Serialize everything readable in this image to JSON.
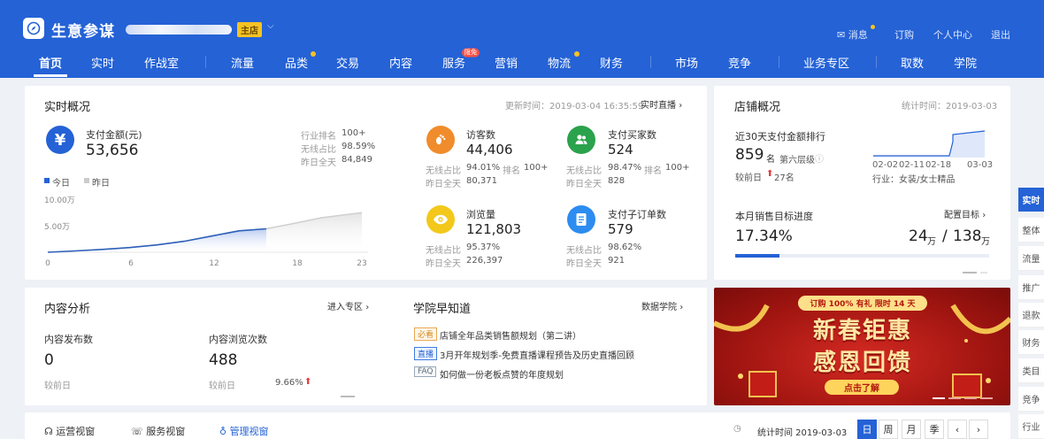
{
  "header": {
    "brand": "生意参谋",
    "shop_badge": "主店",
    "messages": "消息",
    "subscribe": "订购",
    "personal": "个人中心",
    "logout": "退出"
  },
  "nav": [
    "首页",
    "实时",
    "作战室",
    "流量",
    "品类",
    "交易",
    "内容",
    "服务",
    "营销",
    "物流",
    "财务",
    "市场",
    "竞争",
    "业务专区",
    "取数",
    "学院"
  ],
  "nav_tag": "限免",
  "realtime": {
    "title": "实时概况",
    "update_time": "更新时间：2019-03-04 16:35:59",
    "live_link": "实时直播",
    "pay_label": "支付金额(元)",
    "pay_value": "53,656",
    "rank_label": "行业排名",
    "rank_value": "100+",
    "wireless_label": "无线占比",
    "wireless_value": "98.59%",
    "yesterday_label": "昨日全天",
    "yesterday_value": "84,849",
    "legend_today": "今日",
    "legend_yesterday": "昨日",
    "metrics": [
      {
        "label": "访客数",
        "value": "44,406",
        "wireless": "94.01%",
        "rank": "100+",
        "yesterday": "80,371"
      },
      {
        "label": "支付买家数",
        "value": "524",
        "wireless": "98.47%",
        "rank": "100+",
        "yesterday": "828"
      },
      {
        "label": "浏览量",
        "value": "121,803",
        "wireless": "95.37%",
        "yesterday": "226,397"
      },
      {
        "label": "支付子订单数",
        "value": "579",
        "wireless": "98.62%",
        "yesterday": "921"
      }
    ],
    "m_wireless_label": "无线占比",
    "m_rank_label": "排名",
    "m_yesterday_label": "昨日全天"
  },
  "chart_data": {
    "type": "area",
    "x_ticks": [
      "0",
      "6",
      "12",
      "18",
      "23"
    ],
    "y_ticks": [
      "10.00万",
      "5.00万"
    ],
    "ylim": [
      0,
      10
    ],
    "series": [
      {
        "name": "今日",
        "x": [
          0,
          2,
          4,
          6,
          8,
          10,
          12,
          14,
          16
        ],
        "values": [
          0,
          0.25,
          0.55,
          0.9,
          1.4,
          2.1,
          3.1,
          4.1,
          4.5
        ]
      },
      {
        "name": "昨日",
        "x": [
          16,
          18,
          20,
          23
        ],
        "values": [
          4.5,
          5.5,
          6.6,
          7.6
        ]
      }
    ]
  },
  "shop": {
    "title": "店铺概况",
    "stat_time": "统计时间：2019-03-03",
    "rank_title": "近30天支付金额排行",
    "rank_value": "859",
    "rank_unit": "名",
    "rank_level": "第六层级",
    "compare_label": "较前日",
    "compare_value": "27名",
    "dates": [
      "02-02",
      "02-11",
      "02-18",
      "03-03"
    ],
    "industry": "行业：女装/女士精品",
    "target_title": "本月销售目标进度",
    "target_link": "配置目标",
    "progress_text": "17.34%",
    "progress_value": 17.34,
    "sales_current": "24",
    "sales_target": "138",
    "unit": "万",
    "slash": "/"
  },
  "content": {
    "title": "内容分析",
    "link": "进入专区",
    "pub_label": "内容发布数",
    "pub_value": "0",
    "view_label": "内容浏览次数",
    "view_value": "488",
    "compare_label": "较前日",
    "view_change": "9.66%"
  },
  "academy": {
    "title": "学院早知道",
    "link": "数据学院",
    "items": [
      {
        "tag": "必看",
        "text": "店铺全年品类销售额规划（第二讲）"
      },
      {
        "tag": "直播",
        "text": "3月开年规划季-免费直播课程预告及历史直播回顾"
      },
      {
        "tag": "FAQ",
        "text": "如何做一份老板点赞的年度规划"
      }
    ]
  },
  "ad": {
    "top_text": "订购 100% 有礼 限时 14 天",
    "line1": "新春钜惠",
    "line2": "感恩回馈",
    "button": "点击了解"
  },
  "side_tabs": [
    "实时",
    "整体",
    "流量",
    "推广",
    "退款",
    "财务",
    "类目",
    "竞争",
    "行业"
  ],
  "bottom": {
    "tab1": "运营视窗",
    "tab2": "服务视窗",
    "tab3": "管理视窗",
    "stat_time": "统计时间 2019-03-03",
    "periods": [
      "日",
      "周",
      "月",
      "季"
    ],
    "prev": "‹",
    "next": "›"
  }
}
